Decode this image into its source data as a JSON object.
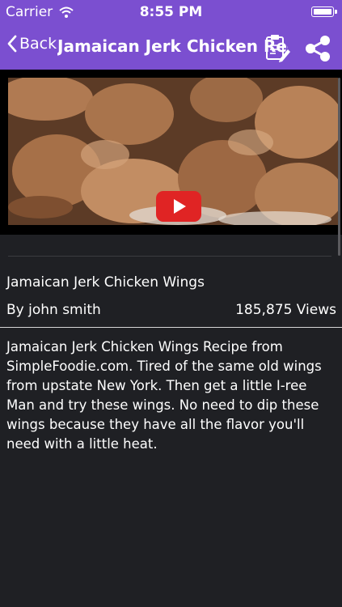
{
  "status_bar": {
    "carrier": "Carrier",
    "time": "8:55 PM"
  },
  "nav": {
    "back_label": "Back",
    "title": "Jamaican Jerk Chicken Recipes"
  },
  "video": {
    "play_icon": "youtube-play-icon"
  },
  "recipe": {
    "title": "Jamaican Jerk Chicken Wings",
    "author": "By john smith",
    "views": "185,875 Views",
    "description": "Jamaican Jerk Chicken Wings Recipe from SimpleFoodie.com. Tired of the same old wings from upstate New York. Then get a little I-ree Man and try these wings. No need to dip these wings because they have all the flavor you'll need with a little heat."
  },
  "colors": {
    "accent": "#7b4fd0",
    "background": "#1f2024",
    "play_button": "#e02424"
  }
}
